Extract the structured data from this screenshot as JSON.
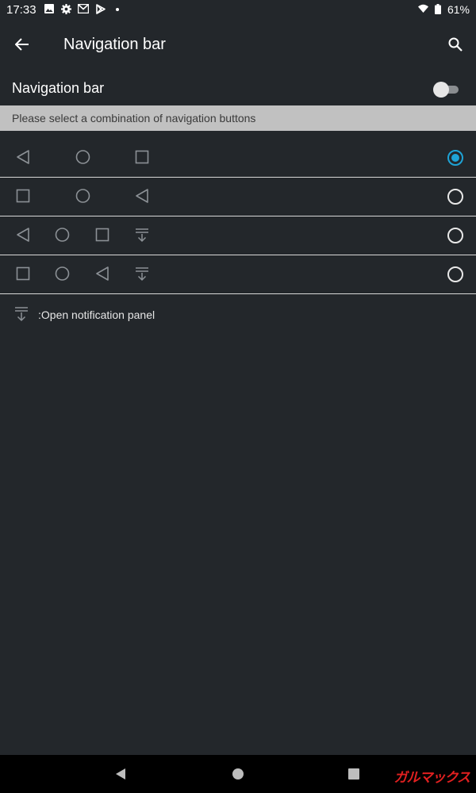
{
  "status_bar": {
    "time": "17:33",
    "left_icons": [
      "image-icon",
      "gear-icon",
      "gmail-icon",
      "play-store-icon",
      "dot-icon"
    ],
    "battery_percent": "61%"
  },
  "app_bar": {
    "title": "Navigation bar"
  },
  "master_switch": {
    "label": "Navigation bar",
    "enabled": false
  },
  "section_header": "Please select a combination of navigation buttons",
  "options": [
    {
      "buttons": [
        "back",
        "home",
        "recents"
      ],
      "selected": true
    },
    {
      "buttons": [
        "recents",
        "home",
        "back"
      ],
      "selected": false
    },
    {
      "buttons": [
        "back",
        "home",
        "recents",
        "notification"
      ],
      "selected": false
    },
    {
      "buttons": [
        "recents",
        "home",
        "back",
        "notification"
      ],
      "selected": false
    }
  ],
  "legend": {
    "icon": "notification-pull-icon",
    "text": ":Open notification panel"
  },
  "system_nav": {
    "buttons": [
      "back-icon",
      "home-icon",
      "recents-icon"
    ],
    "watermark": "ガルマックス"
  },
  "colors": {
    "background": "#23272b",
    "section_header_bg": "#c1c1c1",
    "accent": "#1ea3d6",
    "icon_grey": "#8c9196",
    "watermark": "#e02020"
  }
}
